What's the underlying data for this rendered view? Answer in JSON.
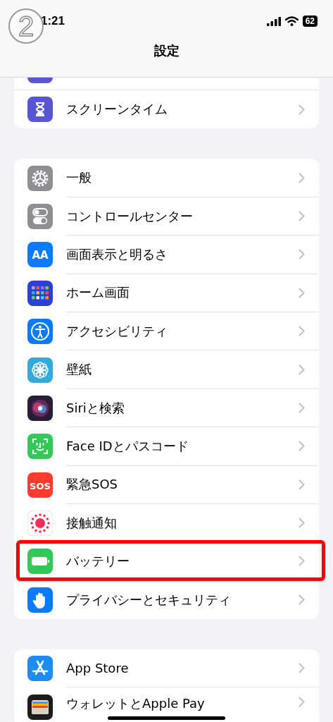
{
  "step_marker": "2",
  "status_bar": {
    "time": "1:21",
    "battery": "62"
  },
  "title": "設定",
  "groups": [
    {
      "partial_top": true,
      "rows": [
        {
          "label": "スクリーンタイム",
          "kind": "hourglass",
          "highlighted": false
        }
      ]
    },
    {
      "partial_top": false,
      "rows": [
        {
          "label": "一般",
          "kind": "gear",
          "highlighted": false
        },
        {
          "label": "コントロールセンター",
          "kind": "toggles",
          "highlighted": false
        },
        {
          "label": "画面表示と明るさ",
          "kind": "textsize",
          "icon_label": "AA",
          "highlighted": false
        },
        {
          "label": "ホーム画面",
          "kind": "grid",
          "highlighted": false
        },
        {
          "label": "アクセシビリティ",
          "kind": "access",
          "highlighted": false
        },
        {
          "label": "壁紙",
          "kind": "flower",
          "highlighted": false
        },
        {
          "label": "Siriと検索",
          "kind": "siri",
          "highlighted": false
        },
        {
          "label": "Face IDとパスコード",
          "kind": "face",
          "highlighted": false
        },
        {
          "label": "緊急SOS",
          "kind": "sos",
          "icon_label": "SOS",
          "highlighted": false
        },
        {
          "label": "接触通知",
          "kind": "exposure",
          "highlighted": false
        },
        {
          "label": "バッテリー",
          "kind": "battery",
          "highlighted": true
        },
        {
          "label": "プライバシーとセキュリティ",
          "kind": "hand",
          "highlighted": false
        }
      ]
    },
    {
      "partial_top": false,
      "rows": [
        {
          "label": "App Store",
          "kind": "appstore",
          "highlighted": false
        },
        {
          "label": "ウォレットとApple Pay",
          "kind": "wallet",
          "highlighted": false
        }
      ]
    }
  ]
}
